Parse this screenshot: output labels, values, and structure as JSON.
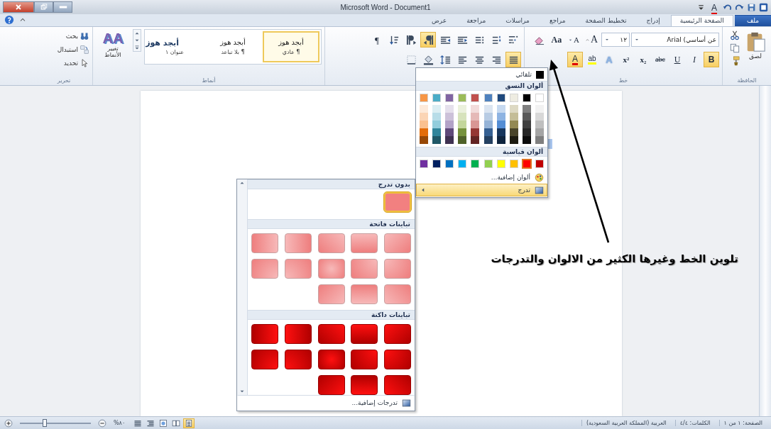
{
  "window": {
    "title": "Microsoft Word - Document1"
  },
  "quick_access": [
    {
      "kind": "word"
    },
    {
      "kind": "save"
    },
    {
      "kind": "redo"
    },
    {
      "kind": "undo"
    },
    {
      "kind": "font-color",
      "label": "A"
    },
    {
      "kind": "more"
    }
  ],
  "window_controls": [
    {
      "kind": "minimize"
    },
    {
      "kind": "restore"
    },
    {
      "kind": "close"
    }
  ],
  "tabs": [
    {
      "label": "ملف",
      "kind": "file",
      "selected": false
    },
    {
      "label": "الصفحة الرئيسية",
      "kind": "tab",
      "selected": true
    },
    {
      "label": "إدراج",
      "kind": "tab",
      "selected": false
    },
    {
      "label": "تخطيط الصفحة",
      "kind": "tab",
      "selected": false
    },
    {
      "label": "مراجع",
      "kind": "tab",
      "selected": false
    },
    {
      "label": "مراسلات",
      "kind": "tab",
      "selected": false
    },
    {
      "label": "مراجعة",
      "kind": "tab",
      "selected": false
    },
    {
      "label": "عرض",
      "kind": "tab",
      "selected": false
    }
  ],
  "ribbon": {
    "clipboard": {
      "label": "الحافظة",
      "paste": "لصق"
    },
    "font": {
      "label": "خط",
      "font_name": "عن أساسي) Arial",
      "font_size": "١٢",
      "row1": [
        {
          "kind": "grow",
          "label": "A",
          "pressed": false
        },
        {
          "kind": "shrink",
          "label": "A",
          "pressed": false
        },
        {
          "kind": "case",
          "label": "Aa",
          "pressed": false
        },
        {
          "kind": "clear-format",
          "pressed": false
        }
      ],
      "row2": [
        {
          "kind": "bold",
          "label": "B",
          "pressed": true
        },
        {
          "kind": "italic",
          "label": "I",
          "pressed": false
        },
        {
          "kind": "underline",
          "label": "U",
          "pressed": false
        },
        {
          "kind": "strike",
          "label": "abc",
          "pressed": false
        },
        {
          "kind": "subscript",
          "label": "x₂",
          "pressed": false
        },
        {
          "kind": "superscript",
          "label": "x²",
          "pressed": false
        },
        {
          "kind": "text-effects",
          "label": "A",
          "pressed": false
        },
        {
          "kind": "highlight",
          "label": "ab",
          "pressed": false
        },
        {
          "kind": "font-color",
          "label": "A",
          "pressed": true
        }
      ]
    },
    "paragraph": {
      "row1": [
        {
          "kind": "multilevel-list",
          "pressed": false
        },
        {
          "kind": "numbered-list",
          "pressed": false
        },
        {
          "kind": "bulleted-list",
          "pressed": false
        },
        {
          "kind": "decrease-indent",
          "pressed": false
        },
        {
          "kind": "increase-indent",
          "pressed": false
        },
        {
          "kind": "rtl",
          "pressed": true
        },
        {
          "kind": "ltr",
          "pressed": false
        },
        {
          "kind": "sort",
          "pressed": false
        },
        {
          "kind": "pilcrow",
          "label": "¶",
          "pressed": false
        }
      ],
      "row2": [
        {
          "kind": "justify",
          "pressed": true
        },
        {
          "kind": "align-right",
          "pressed": false
        },
        {
          "kind": "align-center",
          "pressed": false
        },
        {
          "kind": "align-left",
          "pressed": false
        },
        {
          "kind": "line-spacing",
          "pressed": false
        },
        {
          "kind": "shading",
          "pressed": false
        },
        {
          "kind": "borders",
          "pressed": false
        }
      ]
    },
    "styles": {
      "label": "أنماط",
      "items": [
        {
          "sample": "أبجد هوز",
          "name": "¶ عادي",
          "kind": "normal",
          "selected": true
        },
        {
          "sample": "أبجد هوز",
          "name": "¶ بلا تباعد",
          "kind": "normal",
          "selected": false
        },
        {
          "sample": "أبجد هوز",
          "name": "عنوان ١",
          "kind": "heading",
          "selected": false
        }
      ],
      "change_styles": {
        "glyph": "AA",
        "label": "تغيير الأنماط"
      }
    },
    "editing": {
      "label": "تحرير",
      "items": [
        {
          "kind": "find",
          "label": "بحث"
        },
        {
          "kind": "replace",
          "label": "استبدال"
        },
        {
          "kind": "select",
          "label": "تحديد"
        }
      ]
    }
  },
  "color_menu": {
    "automatic": {
      "label": "تلقائي",
      "color": "#000000"
    },
    "theme_header": "ألوان النسق",
    "theme_colors": [
      {
        "color": "#ffffff",
        "shades": [
          {
            "color": "#f2f2f2"
          },
          {
            "color": "#d8d8d8"
          },
          {
            "color": "#bfbfbf"
          },
          {
            "color": "#a5a5a5"
          },
          {
            "color": "#7f7f7f"
          }
        ]
      },
      {
        "color": "#000000",
        "shades": [
          {
            "color": "#7f7f7f"
          },
          {
            "color": "#595959"
          },
          {
            "color": "#3f3f3f"
          },
          {
            "color": "#262626"
          },
          {
            "color": "#0c0c0c"
          }
        ]
      },
      {
        "color": "#eeece1",
        "shades": [
          {
            "color": "#ddd9c3"
          },
          {
            "color": "#c4bd97"
          },
          {
            "color": "#938953"
          },
          {
            "color": "#494429"
          },
          {
            "color": "#1d1b10"
          }
        ]
      },
      {
        "color": "#1f497d",
        "shades": [
          {
            "color": "#c6d9f0"
          },
          {
            "color": "#8db3e2"
          },
          {
            "color": "#548dd4"
          },
          {
            "color": "#17365d"
          },
          {
            "color": "#0f243e"
          }
        ]
      },
      {
        "color": "#4f81bd",
        "shades": [
          {
            "color": "#dbe5f1"
          },
          {
            "color": "#b8cce4"
          },
          {
            "color": "#95b3d7"
          },
          {
            "color": "#366092"
          },
          {
            "color": "#244061"
          }
        ]
      },
      {
        "color": "#c0504d",
        "shades": [
          {
            "color": "#f2dcdb"
          },
          {
            "color": "#e5b9b7"
          },
          {
            "color": "#d99694"
          },
          {
            "color": "#953734"
          },
          {
            "color": "#632423"
          }
        ]
      },
      {
        "color": "#9bbb59",
        "shades": [
          {
            "color": "#ebf1dd"
          },
          {
            "color": "#d7e3bc"
          },
          {
            "color": "#c3d69b"
          },
          {
            "color": "#76923c"
          },
          {
            "color": "#4f6128"
          }
        ]
      },
      {
        "color": "#8064a2",
        "shades": [
          {
            "color": "#e5e0ec"
          },
          {
            "color": "#ccc1d9"
          },
          {
            "color": "#b2a2c7"
          },
          {
            "color": "#5f497a"
          },
          {
            "color": "#3f3151"
          }
        ]
      },
      {
        "color": "#4bacc6",
        "shades": [
          {
            "color": "#dbeef3"
          },
          {
            "color": "#b7dde8"
          },
          {
            "color": "#92cddc"
          },
          {
            "color": "#31859b"
          },
          {
            "color": "#205867"
          }
        ]
      },
      {
        "color": "#f79646",
        "shades": [
          {
            "color": "#fdeada"
          },
          {
            "color": "#fbd5b5"
          },
          {
            "color": "#fac08f"
          },
          {
            "color": "#e36c09"
          },
          {
            "color": "#974806"
          }
        ]
      }
    ],
    "standard_header": "ألوان قياسية",
    "standard_colors": [
      {
        "color": "#c00000",
        "selected": false
      },
      {
        "color": "#ff0000",
        "selected": true
      },
      {
        "color": "#ffc000",
        "selected": false
      },
      {
        "color": "#ffff00",
        "selected": false
      },
      {
        "color": "#92d050",
        "selected": false
      },
      {
        "color": "#00b050",
        "selected": false
      },
      {
        "color": "#00b0f0",
        "selected": false
      },
      {
        "color": "#0070c0",
        "selected": false
      },
      {
        "color": "#002060",
        "selected": false
      },
      {
        "color": "#7030a0",
        "selected": false
      }
    ],
    "items": [
      {
        "kind": "more-colors",
        "label": "ألوان إضافية...",
        "selected": false
      },
      {
        "kind": "gradient",
        "label": "تدرج",
        "selected": true
      }
    ]
  },
  "gradient_menu": {
    "sections": [
      {
        "kind": "none",
        "header": "بدون تدرج",
        "swatches": [
          {
            "kind": "solid",
            "selected": true
          }
        ]
      },
      {
        "kind": "light",
        "header": "تباينات فاتحة",
        "swatches": [
          {
            "kind": "diagonal-tl",
            "selected": false
          },
          {
            "kind": "down",
            "selected": false
          },
          {
            "kind": "diagonal-tr",
            "selected": false
          },
          {
            "kind": "right",
            "selected": false
          },
          {
            "kind": "left",
            "selected": false
          },
          {
            "kind": "corner-tl",
            "selected": false
          },
          {
            "kind": "corner-tr",
            "selected": false
          },
          {
            "kind": "center",
            "selected": false
          },
          {
            "kind": "corner-bl",
            "selected": false
          },
          {
            "kind": "corner-br",
            "selected": false
          },
          {
            "kind": "diagonal-bl",
            "selected": false
          },
          {
            "kind": "up",
            "selected": false
          },
          {
            "kind": "diagonal-br",
            "selected": false
          }
        ]
      },
      {
        "kind": "dark",
        "header": "تباينات داكنة",
        "swatches": [
          {
            "kind": "diagonal-tl",
            "selected": false
          },
          {
            "kind": "down",
            "selected": false
          },
          {
            "kind": "diagonal-tr",
            "selected": false
          },
          {
            "kind": "right",
            "selected": false
          },
          {
            "kind": "left",
            "selected": false
          },
          {
            "kind": "corner-tl",
            "selected": false
          },
          {
            "kind": "corner-tr",
            "selected": false
          },
          {
            "kind": "center",
            "selected": false
          },
          {
            "kind": "corner-bl",
            "selected": false
          },
          {
            "kind": "corner-br",
            "selected": false
          },
          {
            "kind": "diagonal-bl",
            "selected": false
          },
          {
            "kind": "up",
            "selected": false
          },
          {
            "kind": "diagonal-br",
            "selected": false
          }
        ]
      }
    ],
    "footer": "تدرجات إضافية..."
  },
  "annotation": "تلوين الخط وغيرها الكثير من الالوان والتدرجات",
  "status_bar": {
    "items": [
      "الصفحة: ١ من ١",
      "الكلمات: ٤/٤",
      "العربية (المملكة العربية السعودية)"
    ],
    "views": [
      {
        "kind": "print-layout",
        "selected": true
      },
      {
        "kind": "full-screen",
        "selected": false
      },
      {
        "kind": "web-layout",
        "selected": false
      },
      {
        "kind": "outline",
        "selected": false
      },
      {
        "kind": "draft",
        "selected": false
      }
    ],
    "zoom": "٨٠%",
    "zoom_slider": {
      "level": 0.35
    }
  }
}
